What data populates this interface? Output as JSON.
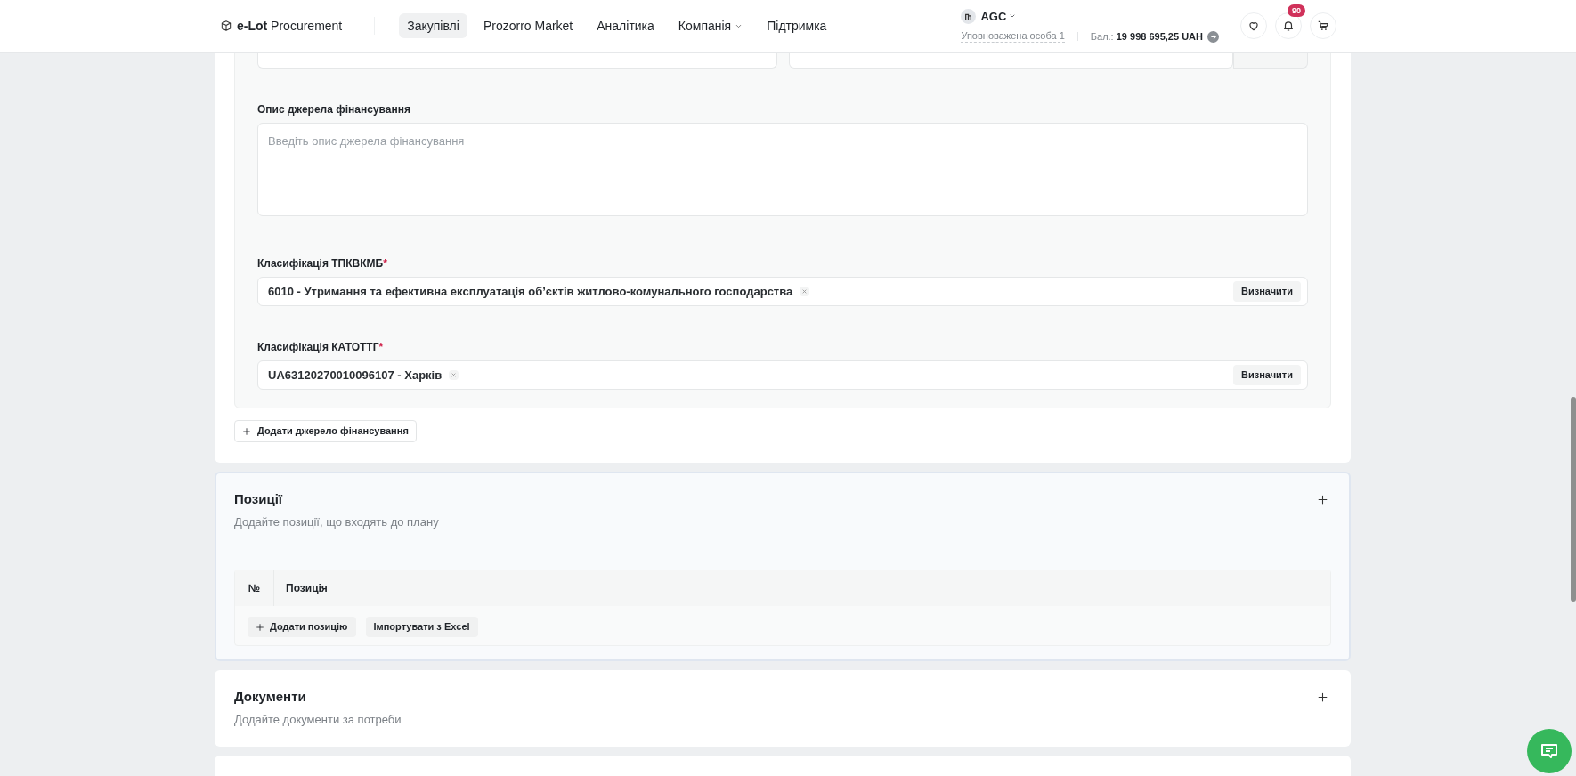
{
  "header": {
    "logo": {
      "brand_bold": "e-Lot",
      "brand_rest": "Procurement"
    },
    "nav": [
      {
        "label": "Закупівлі",
        "selected": true,
        "has_dropdown": false
      },
      {
        "label": "Prozorro Market",
        "selected": false,
        "has_dropdown": false
      },
      {
        "label": "Аналітика",
        "selected": false,
        "has_dropdown": false
      },
      {
        "label": "Компанія",
        "selected": false,
        "has_dropdown": true
      },
      {
        "label": "Підтримка",
        "selected": false,
        "has_dropdown": false
      }
    ],
    "account": {
      "name": "AGC",
      "role": "Уповноважена особа 1",
      "balance_label": "Бал.:",
      "balance": "19 998 695,25 UAH"
    },
    "notifications_badge": "90"
  },
  "funding_source": {
    "description": {
      "label": "Опис джерела фінансування",
      "placeholder": "Введіть опис джерела фінансування"
    },
    "classifications": [
      {
        "label": "Класифікація ТПКВКМБ",
        "required_mark": "*",
        "value": "6010 - Утримання та ефективна експлуатація об’єктів житлово-комунального господарства",
        "button": "Визначити"
      },
      {
        "label": "Класифікація КАТОТТГ",
        "required_mark": "*",
        "value": "UA63120270010096107 - Харків",
        "button": "Визначити"
      }
    ],
    "add_button": "Додати джерело фінансування"
  },
  "sections": [
    {
      "title": "Позиції",
      "subtitle": "Додайте позиції, що входять до плану",
      "highlighted": true,
      "table": {
        "columns": [
          "№",
          "Позиція"
        ],
        "buttons": [
          {
            "label": "Додати позицію",
            "kind": "add"
          },
          {
            "label": "Імпортувати з Excel",
            "kind": "plain"
          }
        ]
      }
    },
    {
      "title": "Документи",
      "subtitle": "Додайте документи за потреби",
      "highlighted": false
    }
  ]
}
